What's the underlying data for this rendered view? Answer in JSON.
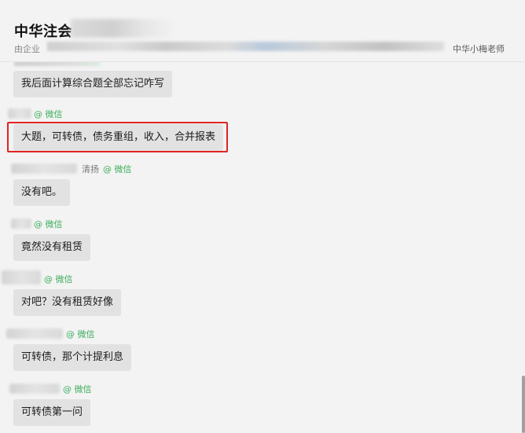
{
  "header": {
    "title": "中华注会",
    "subtitle_prefix": "由企业",
    "subtitle_right": "中华小梅老师"
  },
  "wechat_tag": "@ 微信",
  "messages": [
    {
      "sender": "",
      "text": "我后面计算综合题全部忘记咋写"
    },
    {
      "sender": "",
      "text": "大题，可转债，债务重组，收入，合并报表",
      "highlighted": true
    },
    {
      "sender": "清扬",
      "text": "没有吧。"
    },
    {
      "sender": "",
      "text": "竟然没有租赁"
    },
    {
      "sender": "",
      "text": "对吧？没有租赁好像"
    },
    {
      "sender": "",
      "text": "可转债，那个计提利息"
    },
    {
      "sender": "",
      "text": "可转债第一问"
    }
  ],
  "colors": {
    "background": "#f3f3f3",
    "bubble": "#e2e2e2",
    "wechat_green": "#3cae5b",
    "highlight_red": "#e02424"
  }
}
